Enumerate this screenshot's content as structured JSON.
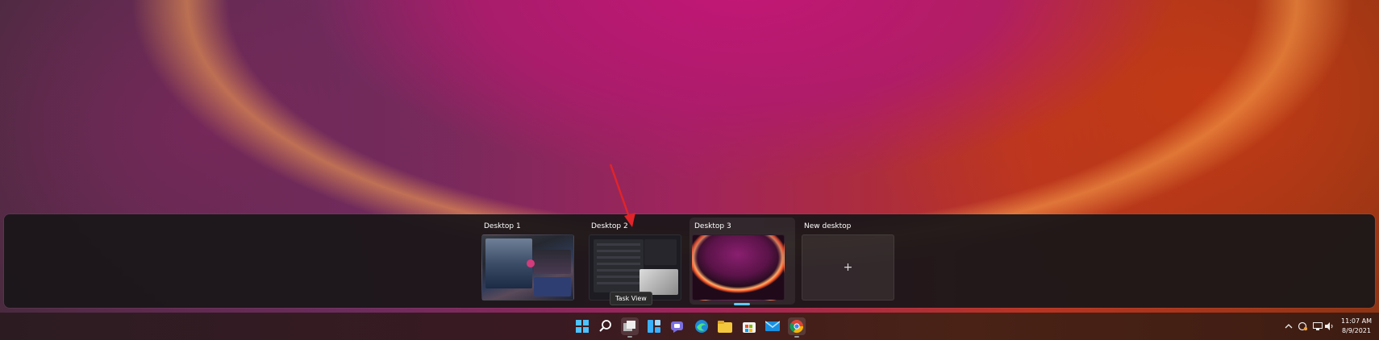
{
  "task_view": {
    "desktops": [
      {
        "label": "Desktop 1"
      },
      {
        "label": "Desktop 2"
      },
      {
        "label": "Desktop 3",
        "selected": true
      },
      {
        "label": "New desktop",
        "add_glyph": "+"
      }
    ],
    "tooltip": "Task View"
  },
  "taskbar": {
    "icons": [
      "windows-start-icon",
      "search-icon",
      "task-view-icon",
      "widgets-icon",
      "teams-chat-icon",
      "edge-icon",
      "file-explorer-icon",
      "store-icon",
      "mail-icon",
      "chrome-icon"
    ],
    "tray_icons": [
      "chevron-up-icon",
      "sync-icon",
      "network-icon",
      "volume-icon"
    ]
  },
  "clock": {
    "time": "11:07 AM",
    "date": "8/9/2021"
  },
  "colors": {
    "accent": "#60c8ff",
    "annotation_arrow": "#e0242a"
  }
}
